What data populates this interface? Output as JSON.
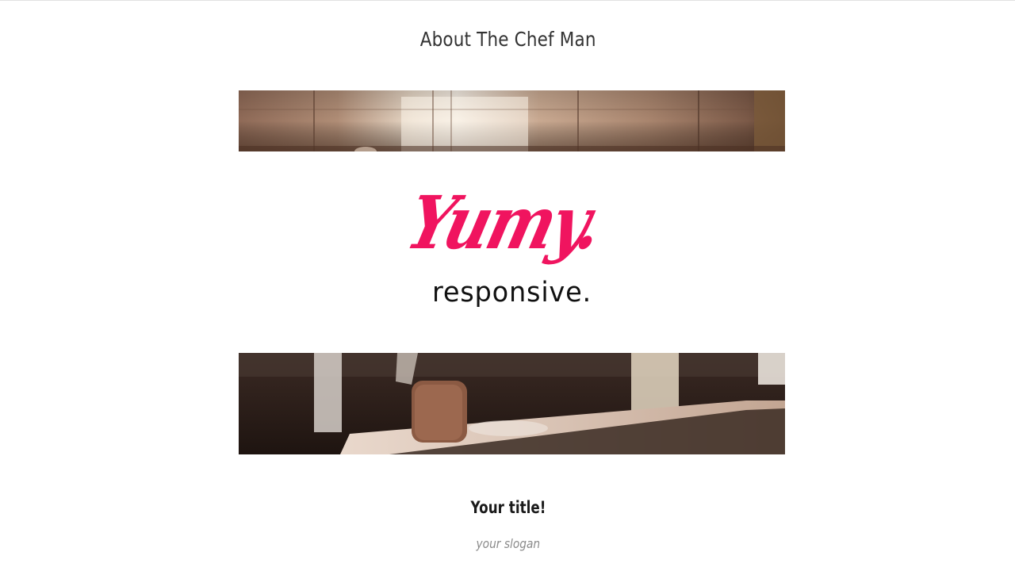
{
  "page": {
    "heading": "About The Chef Man",
    "title": "Your title!",
    "slogan": "your slogan"
  },
  "logo": {
    "script_text": "Yumy.",
    "sub_text": "responsive.",
    "script_color": "#f0145f",
    "sub_color": "#111111"
  },
  "images": {
    "top_photo": "kitchen-interior-photo",
    "bottom_photo": "kitchen-counter-photo"
  }
}
